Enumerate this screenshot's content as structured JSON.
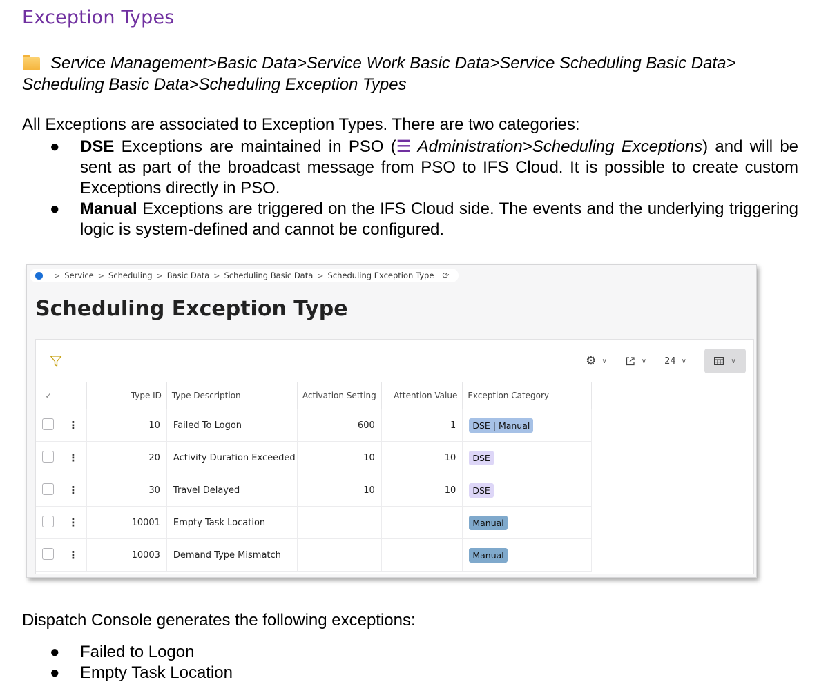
{
  "doc": {
    "heading": "Exception Types",
    "navigation_path_line1": "Service Management>Basic Data>Service Work Basic Data>Service Scheduling Basic Data>",
    "navigation_path_line2": "Scheduling Basic Data>Scheduling Exception Types",
    "intro": "All Exceptions are associated to Exception Types. There are two categories:",
    "bullet_dse_bold": "DSE",
    "bullet_dse_text_a": " Exceptions are maintained in PSO (",
    "bullet_dse_menu_symbol": "☰",
    "bullet_dse_italic": " Administration>Scheduling Exceptions",
    "bullet_dse_text_b": ") and will be sent as part of the broadcast message from PSO to IFS Cloud. It is possible to create custom Exceptions directly in PSO.",
    "bullet_manual_bold": "Manual",
    "bullet_manual_text": " Exceptions are triggered on the IFS Cloud side. The events and the underlying triggering logic is system-defined and cannot be configured.",
    "outro": "Dispatch Console generates the following exceptions:",
    "outro_items": [
      "Failed to Logon",
      "Empty Task Location"
    ]
  },
  "app": {
    "breadcrumb": [
      "Service",
      "Scheduling",
      "Basic Data",
      "Scheduling Basic Data",
      "Scheduling Exception Type"
    ],
    "page_title": "Scheduling Exception Type",
    "page_size": "24",
    "columns": [
      "Type ID",
      "Type Description",
      "Activation Setting",
      "Attention Value",
      "Exception Category"
    ],
    "rows": [
      {
        "type_id": "10",
        "description": "Failed To Logon",
        "activation": "600",
        "attention": "1",
        "category": "DSE | Manual"
      },
      {
        "type_id": "20",
        "description": "Activity Duration Exceeded",
        "activation": "10",
        "attention": "10",
        "category": "DSE"
      },
      {
        "type_id": "30",
        "description": "Travel Delayed",
        "activation": "10",
        "attention": "10",
        "category": "DSE"
      },
      {
        "type_id": "10001",
        "description": "Empty Task Location",
        "activation": "",
        "attention": "",
        "category": "Manual"
      },
      {
        "type_id": "10003",
        "description": "Demand Type Mismatch",
        "activation": "",
        "attention": "",
        "category": "Manual"
      }
    ],
    "colors": {
      "accent_home": "#1a6fd6",
      "badge_mixed": "#a6c1e6",
      "badge_dse": "#ddd6f7",
      "badge_manual": "#7fa9cc"
    }
  }
}
